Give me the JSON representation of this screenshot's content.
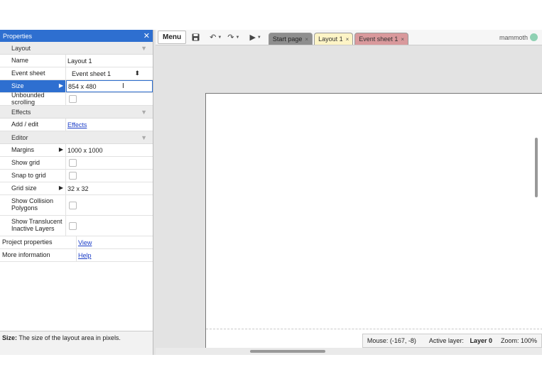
{
  "properties": {
    "title": "Properties",
    "sections": {
      "layout": "Layout",
      "effects": "Effects",
      "editor": "Editor"
    },
    "rows": {
      "name": {
        "key": "Name",
        "value": "Layout 1"
      },
      "event_sheet": {
        "key": "Event sheet",
        "value": "Event sheet 1"
      },
      "size": {
        "key": "Size",
        "value": "854 x 480"
      },
      "unbounded": {
        "key": "Unbounded scrolling"
      },
      "add_edit": {
        "key": "Add / edit",
        "value": "Effects"
      },
      "margins": {
        "key": "Margins",
        "value": "1000 x 1000"
      },
      "show_grid": {
        "key": "Show grid"
      },
      "snap_grid": {
        "key": "Snap to grid"
      },
      "grid_size": {
        "key": "Grid size",
        "value": "32 x 32"
      },
      "collision": {
        "key": "Show Collision Polygons"
      },
      "translucent": {
        "key": "Show Translucent Inactive Layers"
      },
      "project_props": {
        "key": "Project properties",
        "value": "View"
      },
      "more_info": {
        "key": "More information",
        "value": "Help"
      }
    },
    "status": {
      "label": "Size:",
      "text": "The size of the layout area in pixels."
    }
  },
  "toolbar": {
    "menu_label": "Menu",
    "tabs": [
      "Start page",
      "Layout 1",
      "Event sheet 1"
    ],
    "brand": "mammoth"
  },
  "infobar": {
    "mouse": "Mouse: (-167, -8)",
    "active_layer_label": "Active layer:",
    "active_layer_value": "Layer 0",
    "zoom": "Zoom: 100%"
  },
  "colors": {
    "accent": "#2e6fd0",
    "tab_start": "#8e8e8e",
    "tab_layout": "#fdf4c6",
    "tab_event": "#d9999c"
  }
}
